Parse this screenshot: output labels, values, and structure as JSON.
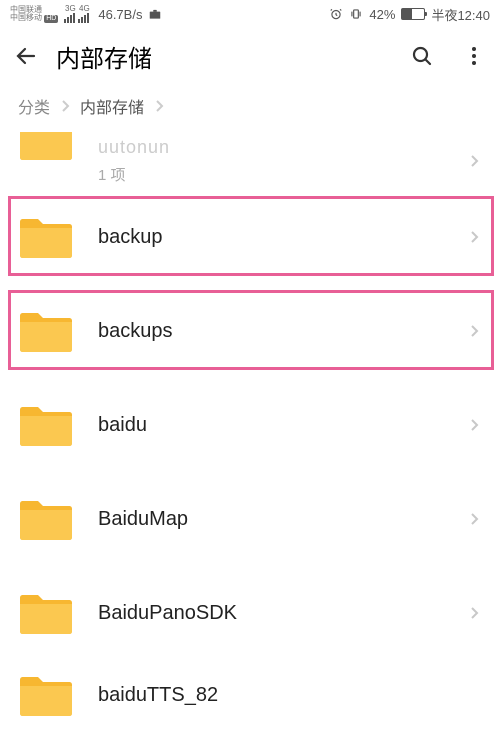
{
  "status": {
    "carrier1": "中国联通",
    "carrier2": "中国移动",
    "net1": "3G",
    "net2": "4G",
    "speed": "46.7B/s",
    "battery_pct": "42%",
    "time": "半夜12:40"
  },
  "header": {
    "title": "内部存储"
  },
  "breadcrumb": {
    "root": "分类",
    "current": "内部存储"
  },
  "rows": [
    {
      "name": "uutonun",
      "sub": "1 项"
    },
    {
      "name": "backup"
    },
    {
      "name": "backups"
    },
    {
      "name": "baidu"
    },
    {
      "name": "BaiduMap"
    },
    {
      "name": "BaiduPanoSDK"
    },
    {
      "name": "baiduTTS_82"
    }
  ]
}
